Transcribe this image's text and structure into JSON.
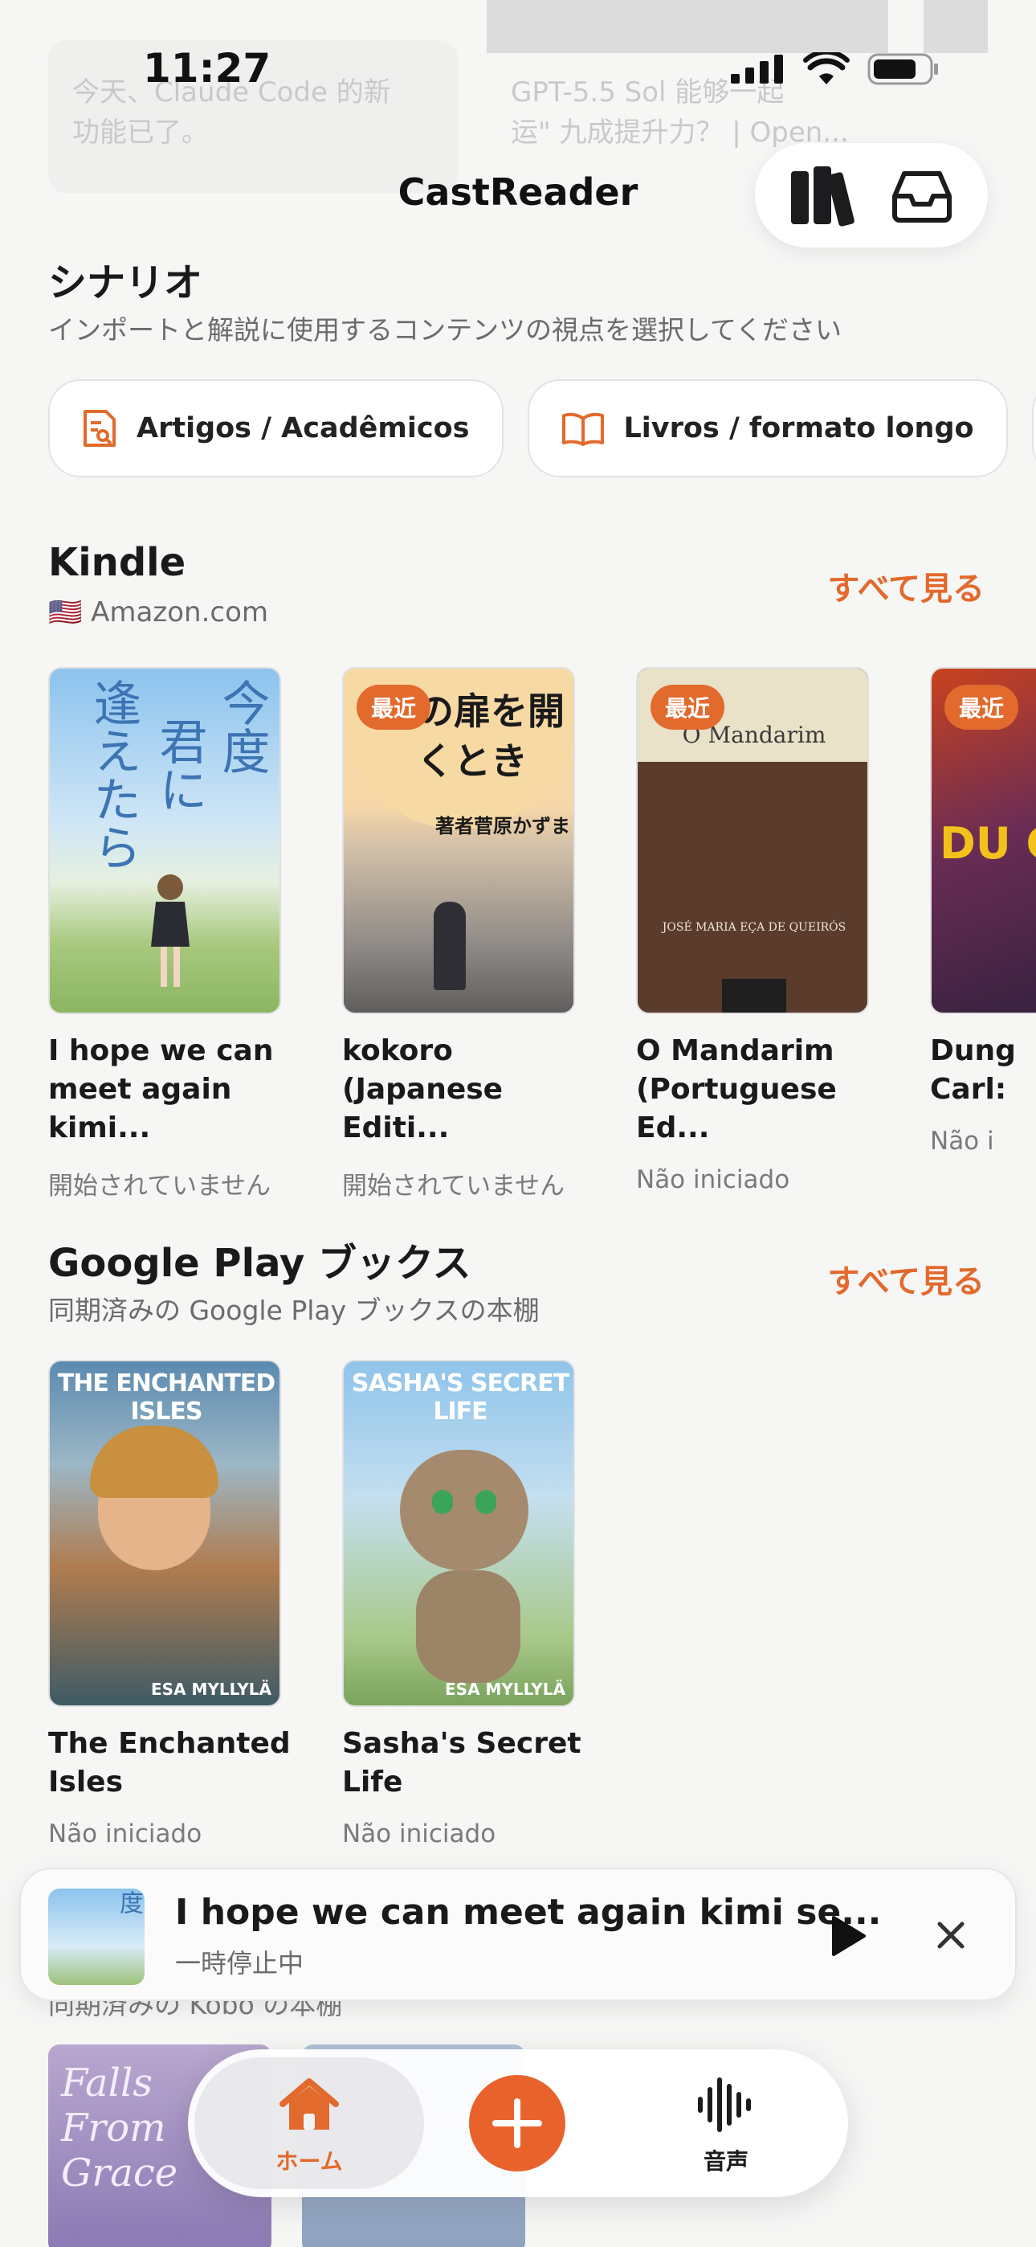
{
  "status": {
    "time": "11:27"
  },
  "background": {
    "text1": "今天、Claude Code 的新",
    "text1b": "功能已了。",
    "text2": "GPT-5.5 Sol 能够一起",
    "text2b": "运\" 九成提升力？ | Open..."
  },
  "nav": {
    "title": "CastReader",
    "library_icon": "books-icon",
    "inbox_icon": "inbox-icon"
  },
  "scenario": {
    "title": "シナリオ",
    "subtitle": "インポートと解説に使用するコンテンツの視点を選択してください",
    "chips": [
      {
        "label": "Artigos / Acadêmicos",
        "icon": "article-icon"
      },
      {
        "label": "Livros / formato longo",
        "icon": "open-book-icon"
      }
    ]
  },
  "kindle": {
    "title": "Kindle",
    "flag": "🇺🇸",
    "store": "Amazon.com",
    "see_all": "すべて見る",
    "books": [
      {
        "title": "I hope we can meet again kimi...",
        "status": "開始されていません",
        "badge": "",
        "cover_text": "今度君に逢えたら"
      },
      {
        "title": "kokoro (Japanese Editi...",
        "status": "開始されていません",
        "badge": "最近",
        "cover_text": "この扉を開くとき",
        "cover_author": "著者菅原かずま"
      },
      {
        "title": "O Mandarim (Portuguese Ed...",
        "status": "Não iniciado",
        "badge": "最近",
        "cover_text": "O Mandarim",
        "cover_author": "JOSÉ MARIA EÇA DE QUEIRÓS"
      },
      {
        "title": "Dung Carl:",
        "status": "Não i",
        "badge": "最近",
        "cover_text": "DU CR"
      }
    ]
  },
  "gplay": {
    "title": "Google Play ブックス",
    "subtitle": "同期済みの Google Play ブックスの本棚",
    "see_all": "すべて見る",
    "books": [
      {
        "title": "The Enchanted Isles",
        "status": "Não iniciado",
        "cover_text": "THE ENCHANTED ISLES",
        "cover_author": "ESA MYLLYLÄ"
      },
      {
        "title": "Sasha's Secret Life",
        "status": "Não iniciado",
        "cover_text": "SASHA'S SECRET LIFE",
        "cover_author": "ESA MYLLYLÄ"
      }
    ]
  },
  "kobo_partial": {
    "subtitle": "同期済みの Kobo の本棚",
    "cover1_text": "Falls From Grace"
  },
  "player": {
    "title": "I hope we can meet again kimi se...",
    "status": "一時停止中"
  },
  "tabs": {
    "home": "ホーム",
    "audio": "音声"
  },
  "colors": {
    "accent": "#e26a2c",
    "background": "#f6f6f5"
  }
}
